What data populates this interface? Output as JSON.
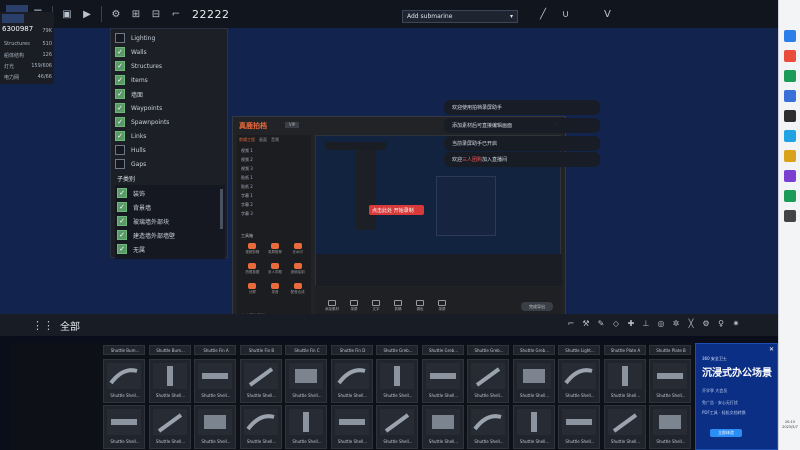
{
  "toolbar": {
    "counter": "22222",
    "submarine_select": "Add submarine",
    "icons": [
      "menu-icon",
      "save-icon",
      "play-icon",
      "settings-icon",
      "link-icon",
      "wrap-icon",
      "bracket-icon"
    ]
  },
  "stats": {
    "id": "6300987",
    "rows": [
      {
        "label": "",
        "value": "79K"
      },
      {
        "label": "Structures",
        "value": "510"
      },
      {
        "label": "船体结构",
        "value": "126"
      },
      {
        "label": "灯光",
        "value": "159/606"
      },
      {
        "label": "电力网",
        "value": "46/66"
      }
    ]
  },
  "layers": {
    "items": [
      {
        "label": "Lighting",
        "checked": false
      },
      {
        "label": "Walls",
        "checked": true
      },
      {
        "label": "Structures",
        "checked": true
      },
      {
        "label": "Items",
        "checked": true
      },
      {
        "label": "墙面",
        "checked": true
      },
      {
        "label": "Waypoints",
        "checked": true
      },
      {
        "label": "Spawnpoints",
        "checked": true
      },
      {
        "label": "Links",
        "checked": true
      },
      {
        "label": "Hulls",
        "checked": false
      },
      {
        "label": "Gaps",
        "checked": false
      }
    ],
    "sub_title": "子类别",
    "sub_items": [
      {
        "label": "装饰",
        "checked": true
      },
      {
        "label": "背景墙",
        "checked": true
      },
      {
        "label": "玻璃墙外部块",
        "checked": true
      },
      {
        "label": "建造墙外部墙壁",
        "checked": true
      },
      {
        "label": "无属",
        "checked": true
      }
    ]
  },
  "video": {
    "title": "真鹿拍档",
    "badge": "VIP",
    "tabs": [
      "剪辑工程",
      "画面",
      "音频"
    ],
    "tracks": [
      "视频 1",
      "视频 2",
      "视频 3",
      "贴纸 1",
      "贴纸 2",
      "字幕 1",
      "字幕 2",
      "字幕 3"
    ],
    "tools_label": "工具箱",
    "tools": [
      "视频剪辑",
      "录屏推荐",
      "去水印",
      "拍照抠图",
      "多人同框",
      "逐帧绘制",
      "分屏",
      "录音",
      "配音合成"
    ],
    "start_text": "点击开始录制",
    "red_tag": "点击此处 开始录制",
    "bar_buttons": [
      "添加素材",
      "录屏",
      "文字",
      "剪辑",
      "调色",
      "录屏"
    ],
    "end_button": "完成导出"
  },
  "notifications": [
    {
      "text": "欢迎使用拍档录屏助手",
      "highlight": ""
    },
    {
      "text": "添加素材后可直接编辑画面",
      "highlight": ""
    },
    {
      "text": "当前录屏助手已开启",
      "highlight": ""
    },
    {
      "text": "欢迎",
      "highlight": "三人团购",
      "tail": "加入直播间"
    }
  ],
  "category": {
    "label": "全部"
  },
  "parts": {
    "row1": [
      "Shuttle Bum...",
      "Shuttle Bum...",
      "Shuttle Fin A",
      "Shuttle Fin B",
      "Shuttle Fin C",
      "Shuttle Fin D",
      "Shuttle Greb...",
      "Shuttle Greb...",
      "Shuttle Greb...",
      "Shuttle Greb...",
      "Shuttle Light...",
      "Shuttle Plate A",
      "Shuttle Plate B"
    ],
    "row2": [
      "Shuttle Shell...",
      "Shuttle Shell...",
      "Shuttle Shell...",
      "Shuttle Shell...",
      "Shuttle Shell...",
      "Shuttle Shell...",
      "Shuttle Shell...",
      "Shuttle Shell...",
      "Shuttle Shell...",
      "Shuttle Shell...",
      "Shuttle Shell...",
      "Shuttle Shell...",
      "Shuttle Shell..."
    ],
    "row3": [
      "Shuttle Shell...",
      "Shuttle Shell...",
      "Shuttle Shell...",
      "Shuttle Shell...",
      "Shuttle Shell...",
      "Shuttle Shell...",
      "Shuttle Shell...",
      "Shuttle Shell...",
      "Shuttle Shell...",
      "Shuttle Shell...",
      "Shuttle Shell...",
      "Shuttle Shell...",
      "Shuttle Shell..."
    ]
  },
  "ad": {
    "top": "360 安全卫士",
    "title": "沉浸式办公场景",
    "lines": [
      "开学季 大会员",
      "免广告 · 安心无打扰",
      "PDF工具 · 轻松文档转换"
    ],
    "button": "立即体验"
  },
  "taskbar": {
    "time": "20:15",
    "date": "2023/5/7"
  }
}
